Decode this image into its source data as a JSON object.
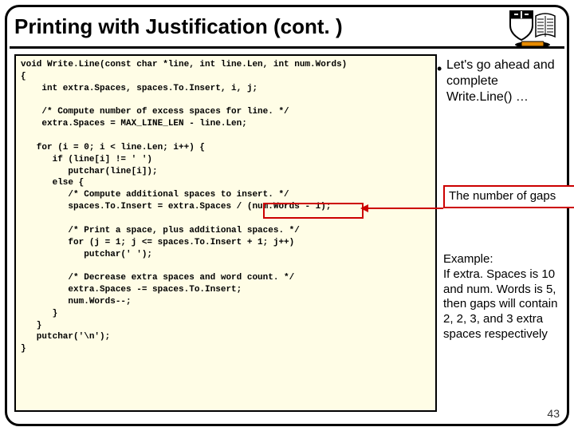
{
  "title": "Printing with Justification (cont. )",
  "code": "void Write.Line(const char *line, int line.Len, int num.Words)\n{\n    int extra.Spaces, spaces.To.Insert, i, j;\n\n    /* Compute number of excess spaces for line. */\n    extra.Spaces = MAX_LINE_LEN - line.Len;\n\n   for (i = 0; i < line.Len; i++) {\n      if (line[i] != ' ')\n         putchar(line[i]);\n      else {\n         /* Compute additional spaces to insert. */\n         spaces.To.Insert = extra.Spaces / (num.Words - 1);\n\n         /* Print a space, plus additional spaces. */\n         for (j = 1; j <= spaces.To.Insert + 1; j++)\n            putchar(' ');\n\n         /* Decrease extra spaces and word count. */\n         extra.Spaces -= spaces.To.Insert;\n         num.Words--;\n      }\n   }\n   putchar('\\n');\n}",
  "bullet": "Let's go ahead and complete Write.Line() …",
  "gaps_label": "The number of gaps",
  "example": "Example:\nIf extra. Spaces is 10 and num. Words is 5, then gaps will contain 2, 2, 3, and 3 extra spaces respectively",
  "page_number": "43"
}
